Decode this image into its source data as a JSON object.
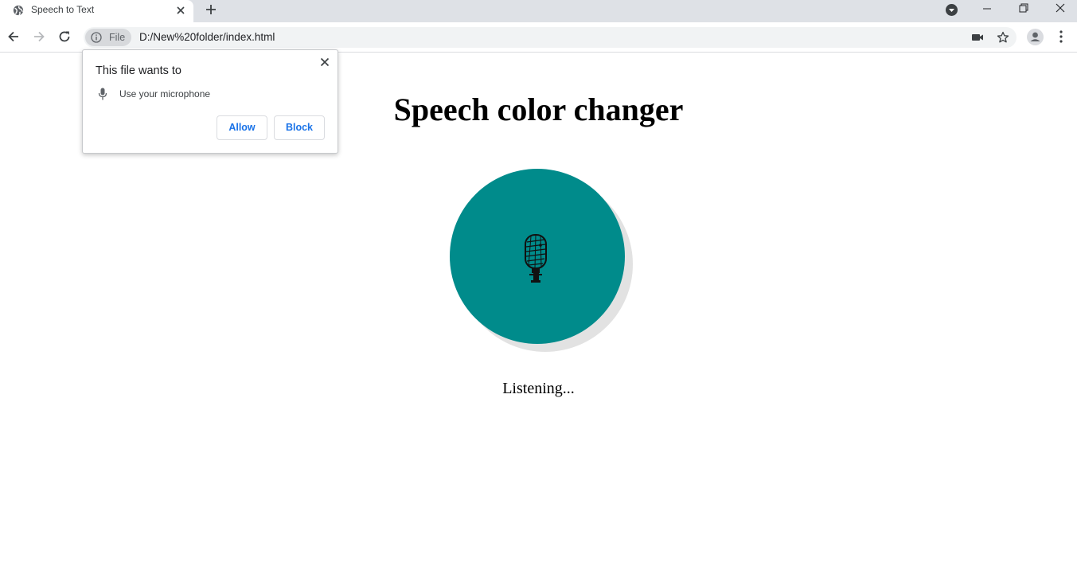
{
  "browser": {
    "tab": {
      "title": "Speech to Text"
    },
    "address_bar": {
      "chip_label": "File",
      "url": "D:/New%20folder/index.html"
    },
    "icons": {
      "favicon": "globe-icon",
      "tab_close": "close-icon",
      "new_tab": "plus-icon",
      "tab_search": "chevron-down-circle-icon",
      "back": "arrow-left-icon",
      "forward": "arrow-right-icon",
      "reload": "reload-icon",
      "site_info": "info-icon",
      "camera": "video-camera-icon",
      "bookmark": "star-icon",
      "profile": "person-icon",
      "menu": "more-vert-icon"
    }
  },
  "permission_prompt": {
    "heading": "This file wants to",
    "request": "Use your microphone",
    "allow_label": "Allow",
    "block_label": "Block"
  },
  "page": {
    "title": "Speech color changer",
    "status": "Listening...",
    "circle_color": "#008b8b",
    "mic_icon": "microphone-icon"
  },
  "colors": {
    "tabstrip": "#dee1e6",
    "accent_link": "#1a73e8"
  }
}
